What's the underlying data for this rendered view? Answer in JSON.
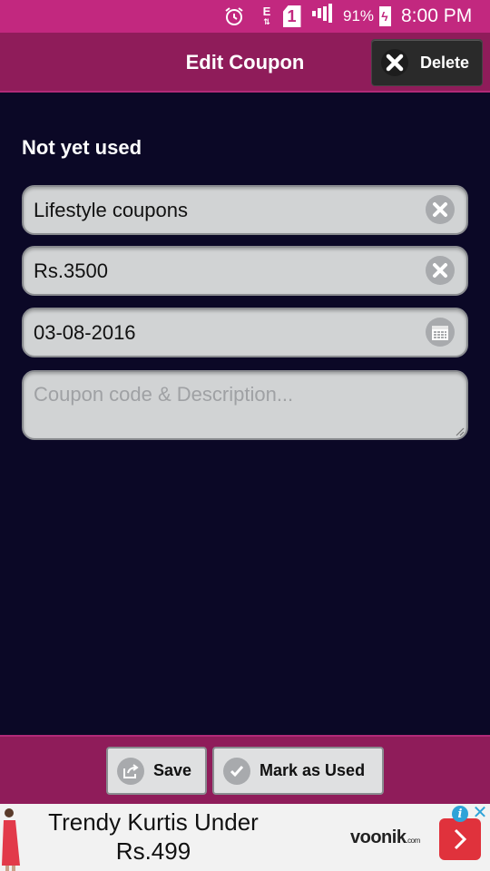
{
  "status_bar": {
    "network_label": "E",
    "sim_label": "1",
    "battery_percent": "91%",
    "time": "8:00 PM",
    "icons": [
      "alarm-icon",
      "data-transfer-icon",
      "sim-icon",
      "signal-icon",
      "battery-charging-icon"
    ]
  },
  "header": {
    "title": "Edit Coupon",
    "delete_label": "Delete"
  },
  "main": {
    "status_label": "Not yet used",
    "name_value": "Lifestyle coupons",
    "amount_value": "Rs.3500",
    "date_value": "03-08-2016",
    "description_value": "",
    "description_placeholder": "Coupon code & Description..."
  },
  "footer": {
    "save_label": "Save",
    "mark_used_label": "Mark as Used"
  },
  "ad": {
    "line1": "Trendy Kurtis Under",
    "line2": "Rs.499",
    "brand": "voonik",
    "brand_suffix": ".com"
  },
  "colors": {
    "status_bar": "#c2287f",
    "header": "#8f1c5a",
    "background": "#0b0826",
    "field": "#d1d3d4",
    "ad_button": "#e0323c"
  }
}
